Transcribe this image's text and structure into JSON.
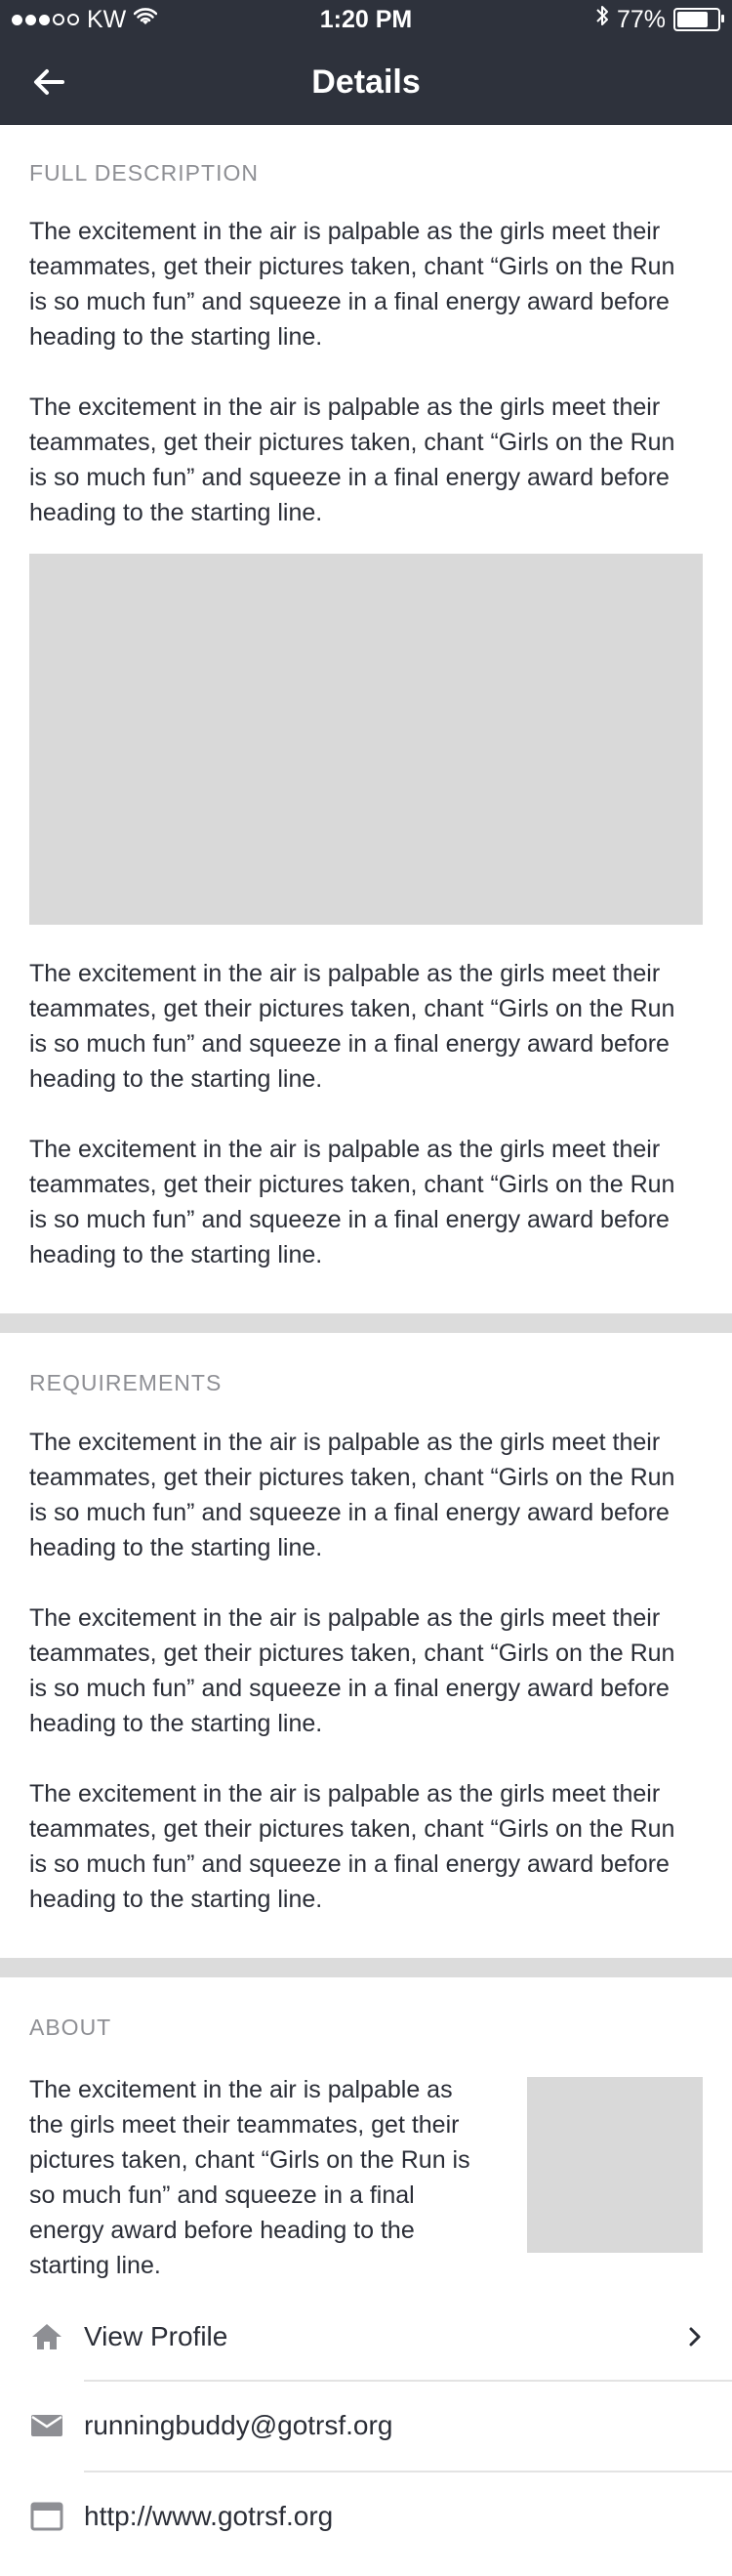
{
  "status_bar": {
    "carrier": "KW",
    "time": "1:20 PM",
    "battery": "77%",
    "battery_level": 0.77
  },
  "nav": {
    "title": "Details"
  },
  "full_description": {
    "heading": "FULL DESCRIPTION",
    "paragraphs": [
      "The excitement in the air is palpable as the girls meet their teammates, get their pictures taken, chant “Girls on the Run is so much fun” and squeeze in a final energy award before heading to the starting line.",
      "The excitement in the air is palpable as the girls meet their teammates, get their pictures taken, chant “Girls on the Run is so much fun” and squeeze in a final energy award before heading to the starting line.",
      "The excitement in the air is palpable as the girls meet their teammates, get their pictures taken, chant “Girls on the Run is so much fun” and squeeze in a final energy award before heading to the starting line.",
      "The excitement in the air is palpable as the girls meet their teammates, get their pictures taken, chant “Girls on the Run is so much fun” and squeeze in a final energy award before heading to the starting line."
    ]
  },
  "requirements": {
    "heading": "REQUIREMENTS",
    "paragraphs": [
      "The excitement in the air is palpable as the girls meet their teammates, get their pictures taken, chant “Girls on the Run is so much fun” and squeeze in a final energy award before heading to the starting line.",
      "The excitement in the air is palpable as the girls meet their teammates, get their pictures taken, chant “Girls on the Run is so much fun” and squeeze in a final energy award before heading to the starting line.",
      "The excitement in the air is palpable as the girls meet their teammates, get their pictures taken, chant “Girls on the Run is so much fun” and squeeze in a final energy award before heading to the starting line."
    ]
  },
  "about": {
    "heading": "ABOUT",
    "text": "The excitement in the air is palpable as the girls meet their teammates, get their pictures taken, chant “Girls on the Run is so much fun” and squeeze in a final energy award before heading to the starting line.",
    "links": {
      "profile": {
        "label": "View Profile",
        "icon": "home-icon"
      },
      "email": {
        "label": "runningbuddy@gotrsf.org",
        "icon": "mail-icon"
      },
      "website": {
        "label": "http://www.gotrsf.org",
        "icon": "browser-icon"
      }
    }
  },
  "colors": {
    "header_bg": "#2e323c",
    "section_heading": "#8e8f94",
    "divider": "#dcdcdc",
    "placeholder": "#d9d9d9"
  }
}
